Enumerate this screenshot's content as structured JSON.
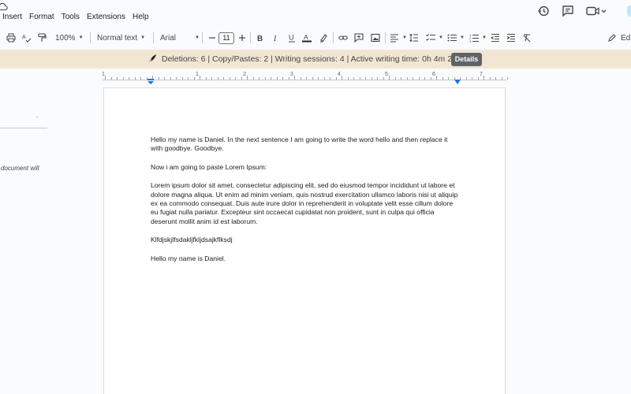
{
  "menu": [
    "Insert",
    "Format",
    "Tools",
    "Extensions",
    "Help"
  ],
  "toolbar": {
    "zoom": "100%",
    "style": "Normal text",
    "font": "Arial",
    "font_size": "11",
    "edit_label": "Edi"
  },
  "notification": {
    "text": "Deletions: 6 | Copy/Pastes: 2 | Writing sessions: 4 | Active writing time: 0h 4m 22s",
    "details_label": "Details"
  },
  "ruler": {
    "numbers": [
      "1",
      "1",
      "2",
      "3",
      "4",
      "5",
      "6",
      "7"
    ]
  },
  "outline": {
    "bullet": ".",
    "text": "document will"
  },
  "document": {
    "paragraphs": [
      "Hello my name is Daniel. In the next sentence I am going to write the word hello and then replace it with goodbye. Goodbye.",
      "Now i am going to paste Lorem Ipsum:",
      "Lorem ipsum dolor sit amet, consectetur adipiscing elit, sed do eiusmod tempor incididunt ut labore et dolore magna aliqua. Ut enim ad minim veniam, quis nostrud exercitation ullamco laboris nisi ut aliquip ex ea commodo consequat. Duis aute irure dolor in reprehenderit in voluptate velit esse cillum dolore eu fugiat nulla pariatur. Excepteur sint occaecat cupidatat non proident, sunt in culpa qui officia deserunt mollit anim id est laborum.",
      "Klfdjskjlfsdakljfkljdsajkflksdj",
      "Hello my name is Daniel."
    ]
  },
  "colors": {
    "notification_bg": "#f2e6d3",
    "details_bg": "#5f6368",
    "ruler_marker": "#1a73e8"
  }
}
